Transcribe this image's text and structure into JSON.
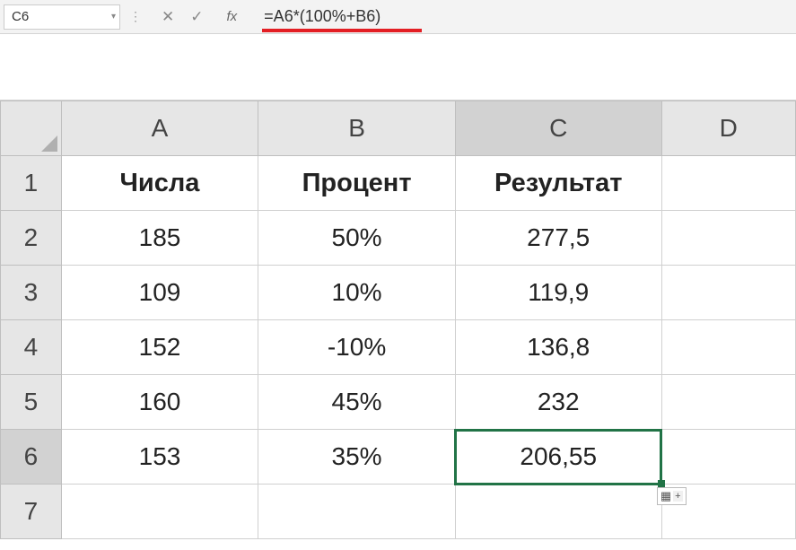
{
  "name_box": "C6",
  "formula": "=A6*(100%+B6)",
  "columns": [
    "A",
    "B",
    "C",
    "D"
  ],
  "rows": [
    "1",
    "2",
    "3",
    "4",
    "5",
    "6",
    "7"
  ],
  "active_col_index": 2,
  "active_row_index": 5,
  "selected_cell": "C6",
  "chart_data": {
    "type": "table",
    "headers": [
      "Числа",
      "Процент",
      "Результат"
    ],
    "rows": [
      [
        "185",
        "50%",
        "277,5"
      ],
      [
        "109",
        "10%",
        "119,9"
      ],
      [
        "152",
        "-10%",
        "136,8"
      ],
      [
        "160",
        "45%",
        "232"
      ],
      [
        "153",
        "35%",
        "206,55"
      ]
    ]
  }
}
